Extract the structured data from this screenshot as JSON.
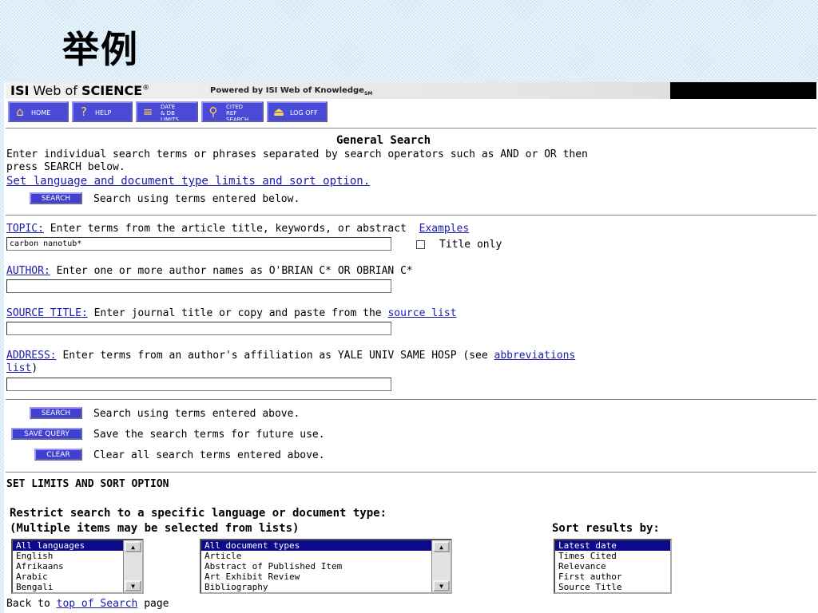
{
  "slide": {
    "title": "举例"
  },
  "header": {
    "logo_isi": "ISI",
    "logo_web_of": " Web of ",
    "logo_science": "SCIENCE",
    "logo_reg": "®",
    "powered": "Powered by ISI Web of Knowledge",
    "powered_sm": "SM"
  },
  "nav": {
    "home": "HOME",
    "help": "HELP",
    "date_limits": "DATE\n& DB\nLIMITS",
    "cited_ref": "CITED\nREF\nSEARCH",
    "logoff": "LOG OFF"
  },
  "search": {
    "heading": "General Search",
    "instructions_1": "Enter individual search terms or phrases separated by search operators such as AND or OR then",
    "instructions_2": "press SEARCH below.",
    "limits_link": "Set language and document type limits and sort option.",
    "search_button": "SEARCH",
    "search_below_text": "Search using terms entered below."
  },
  "fields": {
    "topic_label": "TOPIC:",
    "topic_desc": " Enter terms from the article title, keywords, or abstract  ",
    "topic_examples": "Examples",
    "topic_value": "carbon nanotub*",
    "title_only": "Title only",
    "author_label": "AUTHOR:",
    "author_desc": " Enter one or more author names as O'BRIAN C* OR OBRIAN C*",
    "author_value": "",
    "source_label": "SOURCE TITLE:",
    "source_desc": " Enter journal title or copy and paste from the ",
    "source_link": "source list",
    "source_value": "",
    "address_label": "ADDRESS:",
    "address_desc": " Enter terms from an author's affiliation as YALE UNIV SAME HOSP (see ",
    "address_link_1": "abbreviations",
    "address_link_2": "list",
    "address_close": ")",
    "address_value": ""
  },
  "actions": {
    "search_button": "SEARCH",
    "search_text": "Search using terms entered above.",
    "save_button": "SAVE QUERY",
    "save_text": "Save the search terms for future use.",
    "clear_button": "CLEAR",
    "clear_text": "Clear all search terms entered above."
  },
  "limits": {
    "heading": "SET LIMITS AND SORT OPTION",
    "restrict": "Restrict search to a specific language or document type:",
    "multiple": "(Multiple items may be selected from lists)",
    "sort_label": "Sort results by:",
    "languages": [
      "All languages",
      "English",
      "Afrikaans",
      "Arabic",
      "Bengali"
    ],
    "doc_types": [
      "All document types",
      "Article",
      "Abstract of Published Item",
      "Art Exhibit Review",
      "Bibliography"
    ],
    "sort_options": [
      "Latest date",
      "Times Cited",
      "Relevance",
      "First author",
      "Source Title"
    ]
  },
  "footer": {
    "back_prefix": "Back to ",
    "back_link": "top of Search",
    "back_suffix": " page"
  },
  "colors": {
    "nav_button": "#4a4ad8",
    "action_button": "#4040d0",
    "link": "#1a1ab0",
    "selection": "#0a0a8a"
  }
}
